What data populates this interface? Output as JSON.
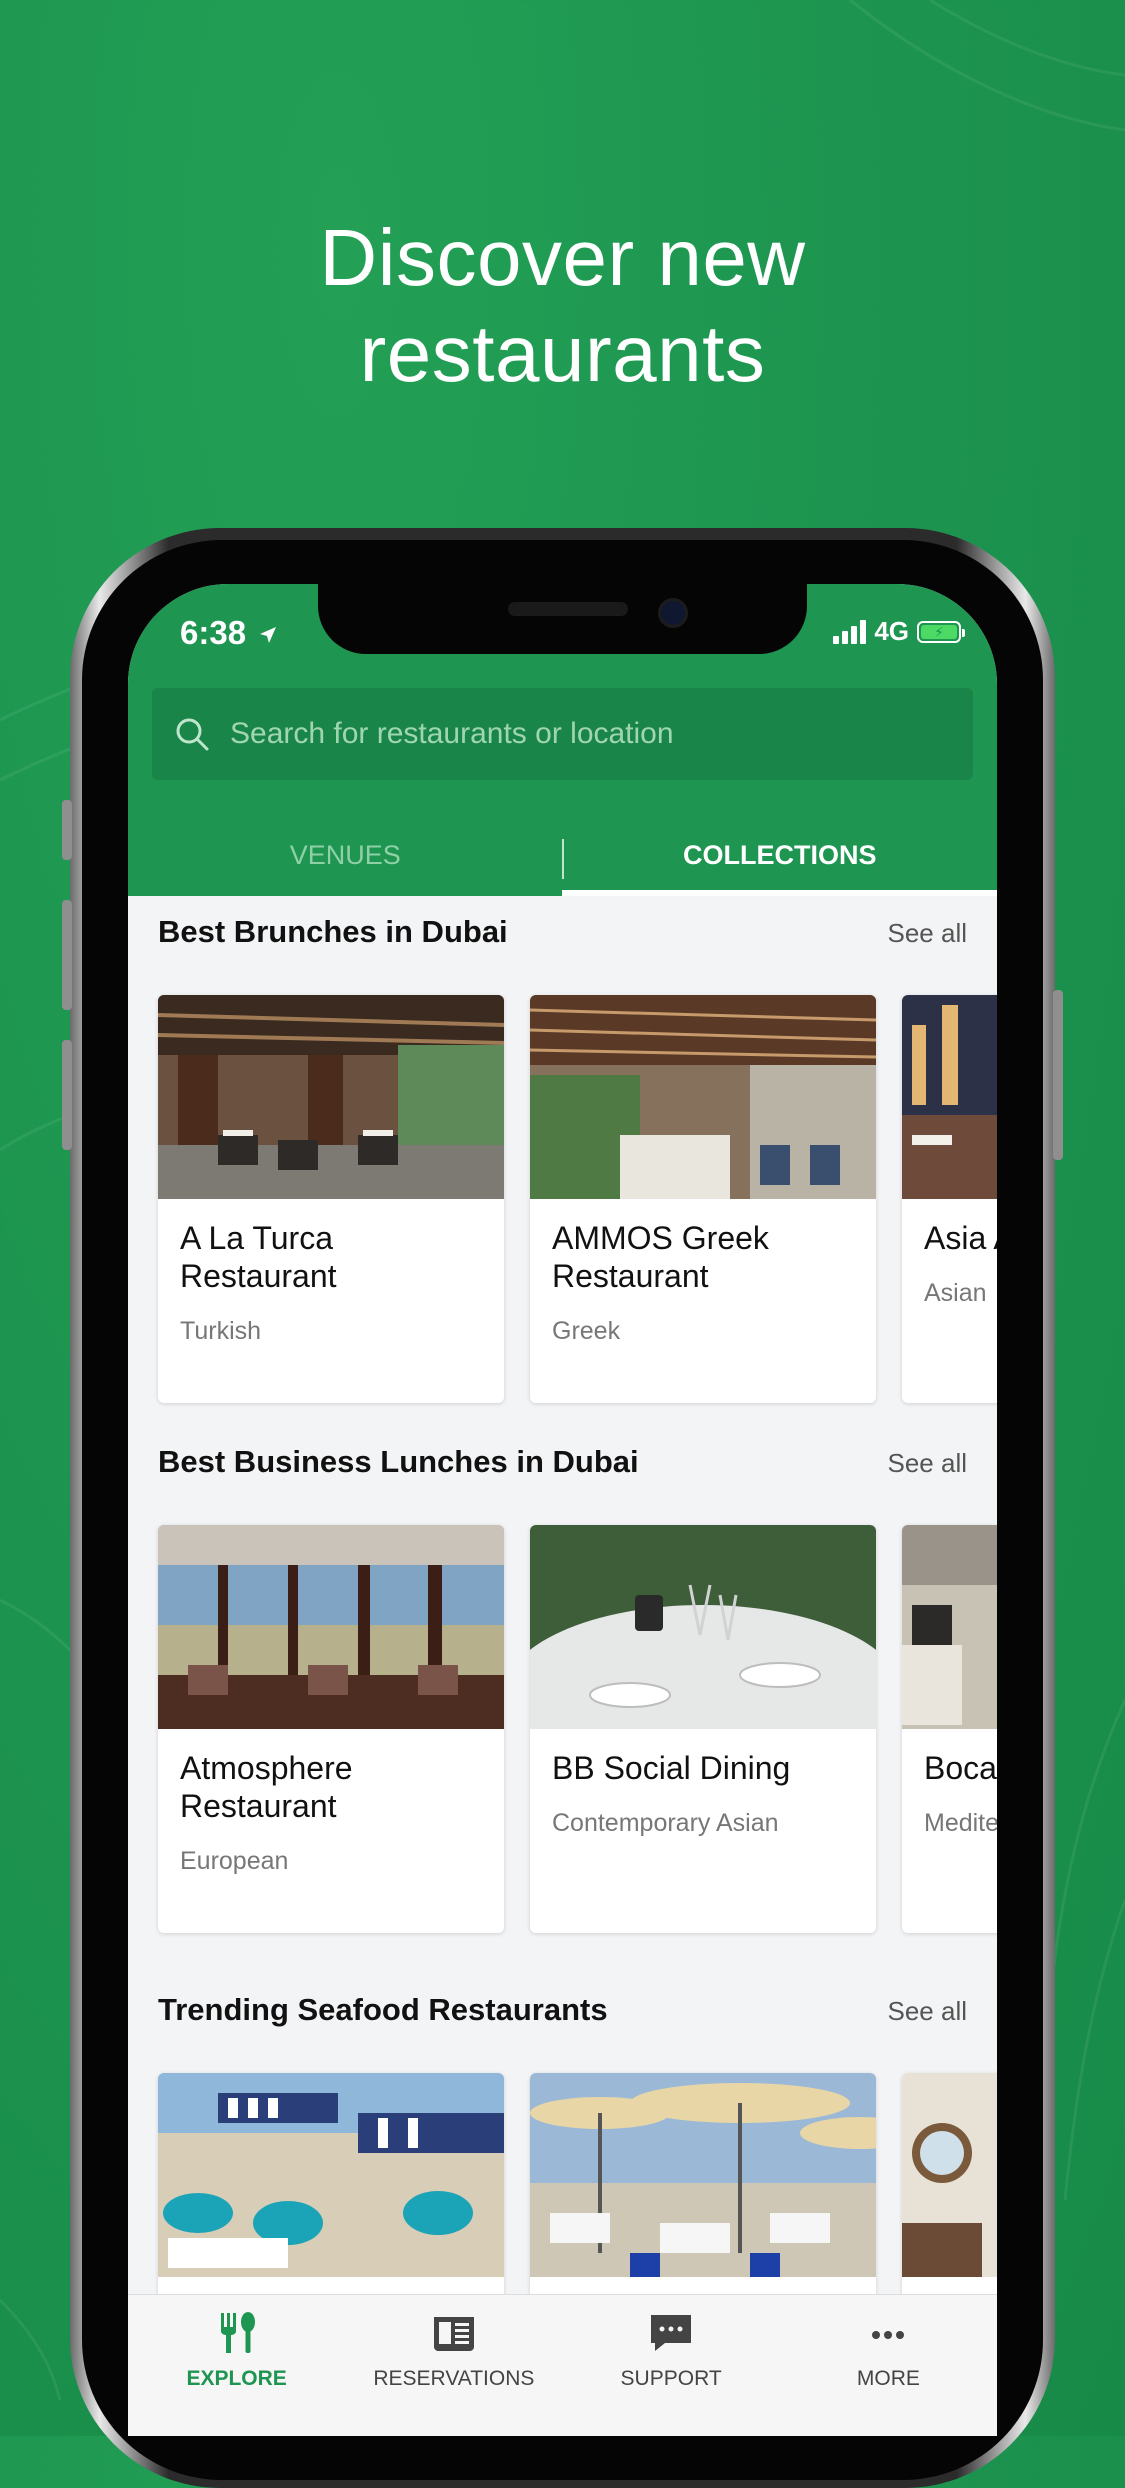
{
  "headline": {
    "line1": "Discover new",
    "line2": "restaurants"
  },
  "status_bar": {
    "time": "6:38",
    "network": "4G"
  },
  "search": {
    "placeholder": "Search for restaurants or location"
  },
  "tabs": [
    {
      "label": "VENUES",
      "active": false
    },
    {
      "label": "COLLECTIONS",
      "active": true
    }
  ],
  "sections": [
    {
      "title": "Best Brunches in Dubai",
      "see_all": "See all",
      "cards": [
        {
          "name": "A La Turca Restaurant",
          "cuisine": "Turkish"
        },
        {
          "name": "AMMOS Greek Restaurant",
          "cuisine": "Greek"
        },
        {
          "name": "Asia A",
          "cuisine": "Asian"
        }
      ]
    },
    {
      "title": "Best Business Lunches in Dubai",
      "see_all": "See all",
      "cards": [
        {
          "name": "Atmosphere Restaurant",
          "cuisine": "European"
        },
        {
          "name": "BB Social Dining",
          "cuisine": "Contemporary Asian"
        },
        {
          "name": "Boca",
          "cuisine": "Medite"
        }
      ]
    },
    {
      "title": "Trending Seafood Restaurants",
      "see_all": "See all",
      "cards": [
        {
          "name": "",
          "cuisine": ""
        },
        {
          "name": "",
          "cuisine": ""
        },
        {
          "name": "",
          "cuisine": ""
        }
      ]
    }
  ],
  "bottom_nav": [
    {
      "label": "EXPLORE",
      "icon": "fork-knife-icon",
      "active": true
    },
    {
      "label": "RESERVATIONS",
      "icon": "newspaper-icon",
      "active": false
    },
    {
      "label": "SUPPORT",
      "icon": "chat-bubble-icon",
      "active": false
    },
    {
      "label": "MORE",
      "icon": "more-dots-icon",
      "active": false
    }
  ],
  "colors": {
    "brand_green": "#1e9551",
    "background_green": "#1d9550",
    "text_dark": "#111111",
    "text_muted": "#777777"
  }
}
